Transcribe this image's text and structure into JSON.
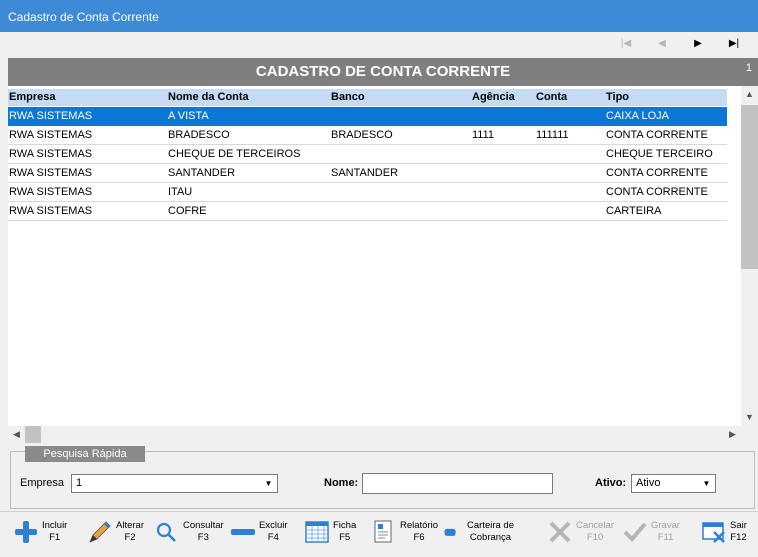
{
  "window": {
    "title": "Cadastro de Conta Corrente"
  },
  "nav": [
    "|◀",
    "◀",
    "▶",
    "▶|"
  ],
  "grid": {
    "title": "CADASTRO DE CONTA CORRENTE",
    "page": "1",
    "columns": [
      "Empresa",
      "Nome da Conta",
      "Banco",
      "Agência",
      "Conta",
      "Tipo"
    ],
    "rows": [
      [
        "RWA SISTEMAS",
        "A VISTA",
        "",
        "",
        "",
        "CAIXA LOJA"
      ],
      [
        "RWA SISTEMAS",
        "BRADESCO",
        "BRADESCO",
        "1111",
        "111111",
        "CONTA CORRENTE"
      ],
      [
        "RWA SISTEMAS",
        "CHEQUE DE TERCEIROS",
        "",
        "",
        "",
        "CHEQUE TERCEIRO"
      ],
      [
        "RWA SISTEMAS",
        "SANTANDER",
        "SANTANDER",
        "",
        "",
        "CONTA CORRENTE"
      ],
      [
        "RWA SISTEMAS",
        "ITAU",
        "",
        "",
        "",
        "CONTA CORRENTE"
      ],
      [
        "RWA SISTEMAS",
        "COFRE",
        "",
        "",
        "",
        "CARTEIRA"
      ]
    ],
    "selected_row": 0
  },
  "search": {
    "title": "Pesquisa Rápida",
    "empresa_label": "Empresa",
    "empresa_value": "1",
    "nome_label": "Nome:",
    "nome_value": "",
    "ativo_label": "Ativo:",
    "ativo_value": "Ativo"
  },
  "toolbar": [
    {
      "label": "Incluir",
      "key": "F1",
      "icon": "plus-icon",
      "enabled": true
    },
    {
      "label": "Alterar",
      "key": "F2",
      "icon": "pencil-icon",
      "enabled": true
    },
    {
      "label": "Consultar",
      "key": "F3",
      "icon": "magnifier-icon",
      "enabled": true
    },
    {
      "label": "Excluir",
      "key": "F4",
      "icon": "minus-icon",
      "enabled": true
    },
    {
      "label": "Ficha",
      "key": "F5",
      "icon": "calendar-icon",
      "enabled": true
    },
    {
      "label": "Relatório",
      "key": "F6",
      "icon": "report-icon",
      "enabled": true
    },
    {
      "label": "Carteira de",
      "key": "Cobrança",
      "icon": "wallet-icon",
      "enabled": true
    },
    {
      "label": "Cancelar",
      "key": "F10",
      "icon": "x-icon",
      "enabled": false
    },
    {
      "label": "Gravar",
      "key": "F11",
      "icon": "check-icon",
      "enabled": false
    },
    {
      "label": "Sair",
      "key": "F12",
      "icon": "exit-icon",
      "enabled": true
    }
  ],
  "colors": {
    "titlebar": "#3d8ad6",
    "selection": "#0b78d7",
    "header": "#c3dcf4",
    "grid_title": "#7f7f7f"
  }
}
